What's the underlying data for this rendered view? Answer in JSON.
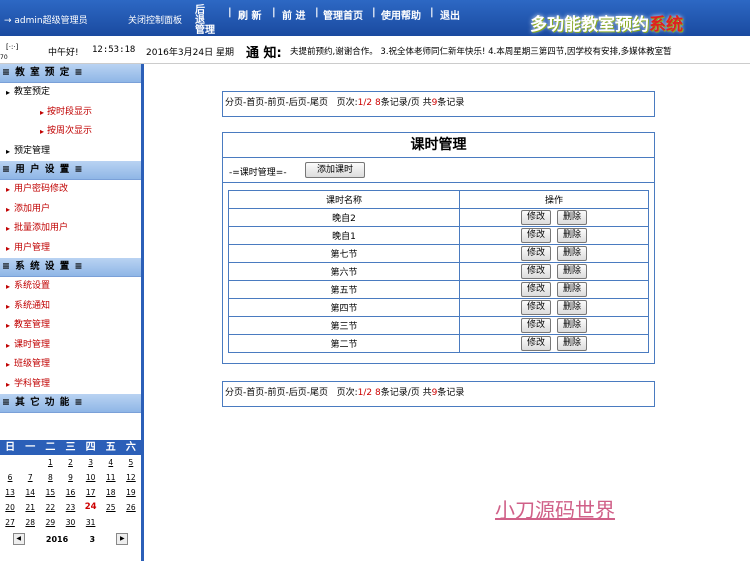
{
  "header": {
    "user": "→ admin超级管理员",
    "close_panel": "关闭控制面板",
    "nav": [
      {
        "label": "后 退 管理"
      },
      {
        "label": "刷 新"
      },
      {
        "label": "前 进"
      },
      {
        "label": "管理首页"
      },
      {
        "label": "使用帮助"
      },
      {
        "label": "退出"
      }
    ],
    "separators": "|",
    "title_main": "多功能教室预约",
    "title_tail": "系统"
  },
  "infobar": {
    "mini_icon_label": "[·:·]",
    "tiny_label": "70",
    "greeting": "中午好!",
    "clock": "12:53:18",
    "date": "2016年3月24日 星期",
    "notice_label": "通 知:",
    "notice_text": "夫提前预约,谢谢合作。 3.祝全体老师同仁新年快乐! 4.本周星期三第四节,因学校有安排,多媒体教室暂"
  },
  "sidebar": {
    "sections": [
      {
        "title": "≡ 教 室 预 定 ≡",
        "items": [
          {
            "label": "教室预定",
            "style": "normal"
          },
          {
            "label": "按时段显示",
            "style": "sub"
          },
          {
            "label": "按周次显示",
            "style": "sub"
          },
          {
            "label": "预定管理",
            "style": "normal"
          }
        ]
      },
      {
        "title": "≡ 用 户 设 置 ≡",
        "items": [
          {
            "label": "用户密码修改",
            "style": "red"
          },
          {
            "label": "添加用户",
            "style": "red"
          },
          {
            "label": "批量添加用户",
            "style": "red"
          },
          {
            "label": "用户管理",
            "style": "red"
          }
        ]
      },
      {
        "title": "≡ 系 统 设 置 ≡",
        "items": [
          {
            "label": "系统设置",
            "style": "red"
          },
          {
            "label": "系统通知",
            "style": "red"
          },
          {
            "label": "教室管理",
            "style": "red"
          },
          {
            "label": "课时管理",
            "style": "red"
          },
          {
            "label": "班级管理",
            "style": "red"
          },
          {
            "label": "学科管理",
            "style": "red"
          }
        ]
      },
      {
        "title": "≡ 其 它 功 能 ≡",
        "items": []
      }
    ]
  },
  "calendar": {
    "weekdays": [
      "日",
      "一",
      "二",
      "三",
      "四",
      "五",
      "六"
    ],
    "weeks": [
      [
        "",
        "",
        "1",
        "2",
        "3",
        "4",
        "5"
      ],
      [
        "6",
        "7",
        "8",
        "9",
        "10",
        "11",
        "12"
      ],
      [
        "13",
        "14",
        "15",
        "16",
        "17",
        "18",
        "19"
      ],
      [
        "20",
        "21",
        "22",
        "23",
        "24",
        "25",
        "26"
      ],
      [
        "27",
        "28",
        "29",
        "30",
        "31",
        "",
        ""
      ]
    ],
    "today": "24",
    "year": "2016",
    "month": "3",
    "prev": "◀",
    "next": "▶"
  },
  "pager": {
    "links": "分页-首页-前页-后页-尾页",
    "page_label": "页次:",
    "page_value": "1/2",
    "per_page_value": "8",
    "per_page_label": "条记录/页",
    "total_label": "共",
    "total_value": "9",
    "total_unit": "条记录"
  },
  "management": {
    "title": "课时管理",
    "toolbar_label": "-=课时管理=-",
    "add_button": "添加课时",
    "columns": [
      "课时名称",
      "操作"
    ],
    "edit_label": "修改",
    "delete_label": "删除",
    "rows": [
      {
        "name": "晚自2"
      },
      {
        "name": "晚自1"
      },
      {
        "name": "第七节"
      },
      {
        "name": "第六节"
      },
      {
        "name": "第五节"
      },
      {
        "name": "第四节"
      },
      {
        "name": "第三节"
      },
      {
        "name": "第二节"
      }
    ]
  },
  "watermark": "小刀源码世界"
}
